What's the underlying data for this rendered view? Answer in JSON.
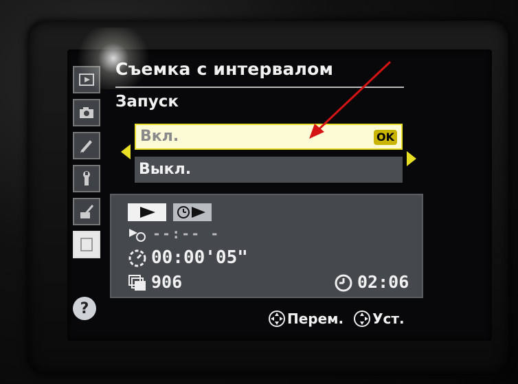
{
  "menu": {
    "title": "Съемка с интервалом",
    "section": "Запуск",
    "options": [
      {
        "label": "Вкл.",
        "selected": true,
        "badge": "OK"
      },
      {
        "label": "Выкл.",
        "selected": false
      }
    ]
  },
  "info": {
    "start_time": "--:-- -",
    "interval": "00:00'05\"",
    "shots": "906",
    "clock": "02:06"
  },
  "help_bar": {
    "move_label": "Перем.",
    "set_label": "Уст."
  },
  "rail": {
    "tabs": [
      {
        "icon": "playback-icon"
      },
      {
        "icon": "camera-icon"
      },
      {
        "icon": "pencil-icon"
      },
      {
        "icon": "wrench-icon"
      },
      {
        "icon": "retouch-icon"
      },
      {
        "icon": "recent-settings-icon",
        "active": true
      }
    ],
    "help": "?"
  },
  "colors": {
    "accent_yellow": "#e9df25",
    "annotation_red": "#d41414",
    "panel": "#45494e"
  }
}
